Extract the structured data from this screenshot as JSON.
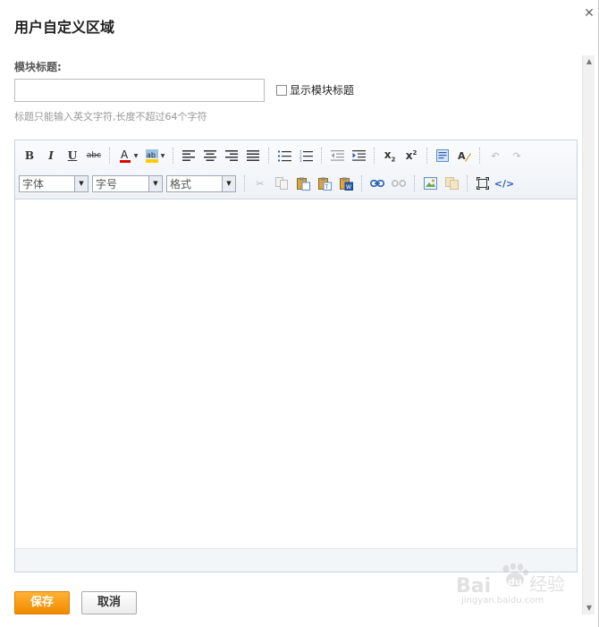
{
  "dialog": {
    "title": "用户自定义区域",
    "close_icon": "close-icon"
  },
  "form": {
    "title_label": "模块标题:",
    "title_input_value": "",
    "show_title_label": "显示模块标题",
    "show_title_checked": false,
    "hint": "标题只能输入英文字符,长度不超过64个字符"
  },
  "toolbar": {
    "font_select": "字体",
    "size_select": "字号",
    "format_select": "格式",
    "buttons_row1": [
      "bold",
      "italic",
      "underline",
      "strikethrough",
      "font-color",
      "background-color",
      "align-left",
      "align-center",
      "align-right",
      "align-justify",
      "bulleted-list",
      "numbered-list",
      "outdent",
      "indent",
      "subscript",
      "superscript",
      "select-all",
      "clear-format",
      "undo",
      "redo"
    ],
    "buttons_row2": [
      "cut",
      "copy",
      "paste",
      "paste-text",
      "paste-word",
      "link",
      "unlink",
      "insert-image",
      "insert-flash",
      "fullscreen",
      "source-code"
    ],
    "colors": {
      "font_color_bar": "#e00000",
      "bg_color_bar": "#ffcc00"
    }
  },
  "actions": {
    "save_label": "保存",
    "cancel_label": "取消"
  },
  "watermark": {
    "logo_text": "Bai经验",
    "url": "jingyan.baidu.com"
  },
  "colors": {
    "save_button": "#f39400",
    "editor_border": "#c6d3e0"
  }
}
